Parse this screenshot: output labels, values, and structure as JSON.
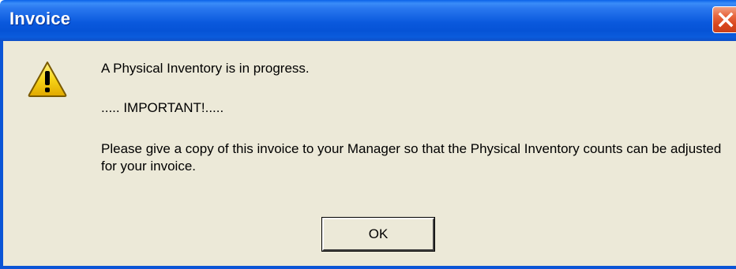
{
  "window": {
    "title": "Invoice"
  },
  "titlebar": {
    "close_icon": "close-icon"
  },
  "message": {
    "icon": "warning-icon",
    "line1": "A Physical Inventory is in progress.",
    "line2": "..... IMPORTANT!.....",
    "line3": "Please give a copy of this invoice to your Manager so that the Physical Inventory counts can be adjusted for your invoice."
  },
  "buttons": {
    "ok_label": "OK"
  },
  "colors": {
    "titlebar_blue": "#0a59dd",
    "client_bg": "#ece9d8",
    "close_red": "#d8461d",
    "warning_yellow": "#f7d417"
  }
}
